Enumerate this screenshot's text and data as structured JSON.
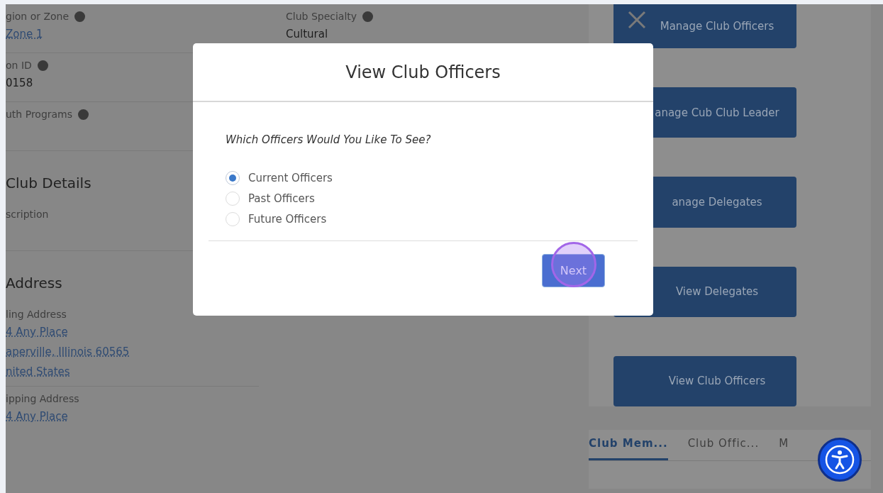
{
  "record": {
    "left_fields": [
      {
        "label": "gion or Zone",
        "info": true,
        "lines": [
          "Zone 1"
        ],
        "link": true
      },
      {
        "label": "on ID",
        "info": true,
        "lines": [
          "0158"
        ],
        "link": false
      },
      {
        "label": "uth Programs",
        "info": true
      }
    ],
    "middle_fields": [
      {
        "label": "Club Specialty",
        "info": true,
        "lines": [
          "Cultural"
        ],
        "link": false
      }
    ],
    "sections": [
      {
        "title": "Club Details",
        "fields": [
          {
            "label": "scription",
            "info": false
          }
        ]
      },
      {
        "title": "Address",
        "fields": [
          {
            "label": "ling Address",
            "info": false,
            "lines": [
              "4 Any Place",
              "aperville, Illinois 60565",
              "nited States"
            ],
            "link": true
          },
          {
            "label": "ipping Address",
            "info": false,
            "lines": [
              "4 Any Place"
            ],
            "link": true
          }
        ]
      }
    ]
  },
  "actions": [
    "Manage Club Officers",
    "anage Cub Club Leader",
    "anage Delegates",
    "View Delegates",
    "View Club Officers"
  ],
  "related_tabs": [
    {
      "label": "Club Mem...",
      "selected": true
    },
    {
      "label": "Club Offic...",
      "selected": false
    },
    {
      "label": "M",
      "selected": false
    }
  ],
  "modal": {
    "title": "View Club Officers",
    "question": "Which Officers Would You Like To See?",
    "options": [
      {
        "label": "Current Officers",
        "selected": true
      },
      {
        "label": "Past Officers",
        "selected": false
      },
      {
        "label": "Future Officers",
        "selected": false
      }
    ],
    "next_button": "Next",
    "next_highlighted": true
  }
}
